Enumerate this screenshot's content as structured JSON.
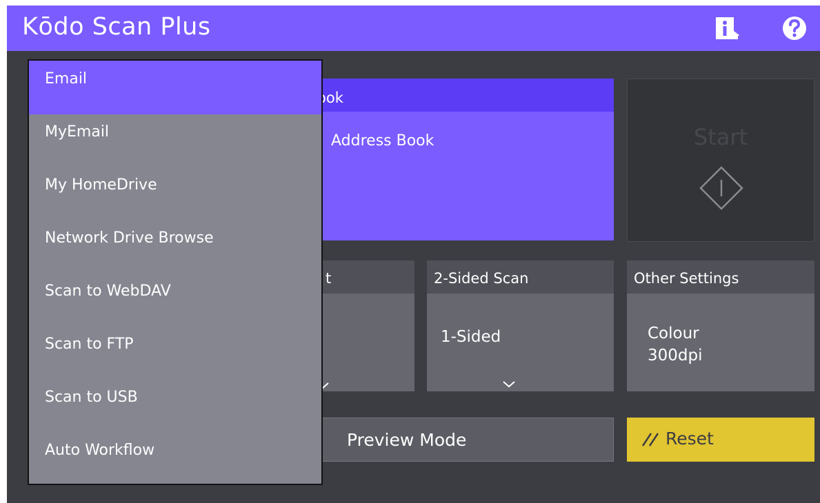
{
  "app": {
    "title": "Kōdo Scan Plus"
  },
  "header": {
    "info_icon": "info-icon",
    "help_icon": "help-icon"
  },
  "destination": {
    "header_label": "ook",
    "value": "Address Book"
  },
  "start": {
    "label": "Start",
    "icon": "start-diamond-icon"
  },
  "settings": {
    "left": {
      "header": "t"
    },
    "two_sided": {
      "header": "2-Sided Scan",
      "value": "1-Sided"
    },
    "other": {
      "header": "Other Settings",
      "value": "Colour\n300dpi"
    }
  },
  "actions": {
    "preview_label": "Preview Mode",
    "reset_label": "Reset"
  },
  "dropdown": {
    "selected_index": 0,
    "items": [
      {
        "label": "Email"
      },
      {
        "label": "MyEmail"
      },
      {
        "label": "My HomeDrive"
      },
      {
        "label": "Network Drive Browse"
      },
      {
        "label": "Scan to WebDAV"
      },
      {
        "label": "Scan to FTP"
      },
      {
        "label": "Scan to USB"
      },
      {
        "label": "Auto Workflow"
      }
    ]
  },
  "colors": {
    "accent": "#7a5cff",
    "accent_dark": "#5c3cf5",
    "background": "#3c3d43",
    "reset": "#e1c531",
    "dropdown_bg": "#858690"
  }
}
